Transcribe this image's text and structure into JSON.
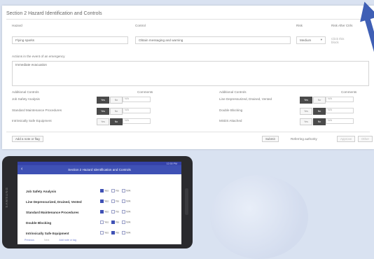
{
  "form": {
    "title": "Section 2 Hazard Identification and Controls",
    "col_hazard": "Hazard",
    "col_control": "Control",
    "col_risk": "Risk",
    "col_risk_after": "Risk After Ctrls",
    "hazard_value": "Flying sparks",
    "control_value": "Obtain messaging and warning",
    "risk_value": "Medium",
    "risk_after_value": "Click this block",
    "emergency_label": "Actions in the event of an emergency",
    "emergency_value": "Immediate evacuation",
    "additional_controls_label": "Additional Controls",
    "comments_label": "Comments",
    "yes": "Yes",
    "no": "No",
    "na": "N/A",
    "left_controls": [
      {
        "label": "Job Safety Analysis",
        "state": "yes"
      },
      {
        "label": "Standard Maintenance Procedures",
        "state": "yes"
      },
      {
        "label": "Intrinsically Safe Equipment",
        "state": "no"
      }
    ],
    "right_controls": [
      {
        "label": "Line Depressurized, Drained, Vented",
        "state": "yes"
      },
      {
        "label": "Double Blocking",
        "state": "no"
      },
      {
        "label": "MSDS Attached",
        "state": "no"
      }
    ],
    "add_note_button": "Add a note or flag",
    "submit_button": "Submit",
    "referring_text": "Referring authority",
    "approve_button": "Approve",
    "other_button": "Other"
  },
  "tablet": {
    "brand": "SAMSUNG",
    "status_text": "12:30 PM",
    "app_title": "Section 2 Hazard Identification and Controls",
    "rows": [
      {
        "label": "Job Safety Analysis",
        "state": "yes"
      },
      {
        "label": "Line Depressurized, Drained, Vented",
        "state": "yes"
      },
      {
        "label": "Standard Maintenance Procedures",
        "state": "yes"
      },
      {
        "label": "Double Blocking",
        "state": "no"
      },
      {
        "label": "Intrinsically Safe Equipment",
        "state": "no"
      }
    ],
    "yes": "Yes",
    "no": "No",
    "na": "N/A",
    "footer": [
      "Previous",
      "Next",
      "Add note or tag"
    ]
  },
  "colors": {
    "accent": "#3f51b5",
    "background": "#d9e2f1",
    "toggle_on": "#4a4a4a",
    "arrow": "#3f5fb5"
  }
}
